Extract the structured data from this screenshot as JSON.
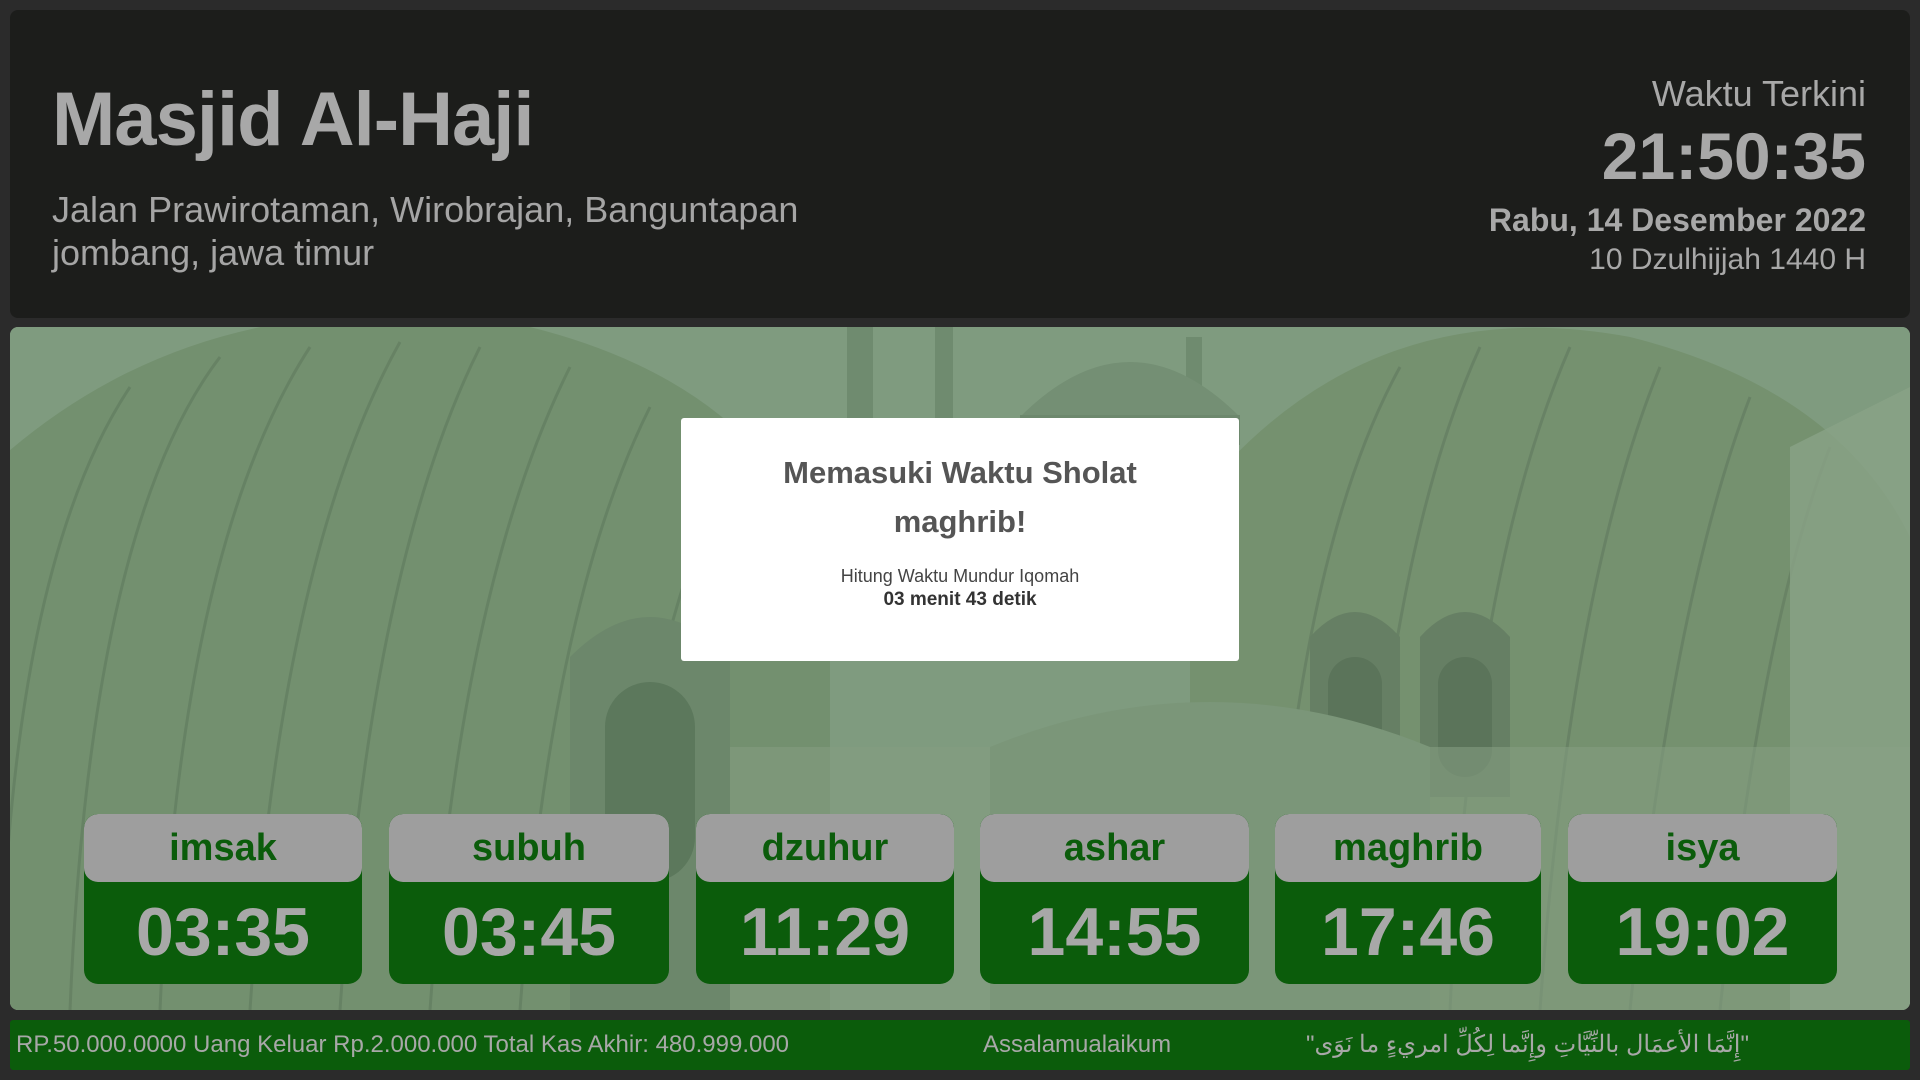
{
  "header": {
    "mosque_name": "Masjid Al-Haji",
    "address_line1": "Jalan Prawirotaman, Wirobrajan, Banguntapan",
    "address_line2": "jombang, jawa timur",
    "clock_label": "Waktu Terkini",
    "clock_time": "21:50:35",
    "date": "Rabu, 14 Desember 2022",
    "hijri_date": "10 Dzulhijjah 1440 H"
  },
  "modal": {
    "title_line1": "Memasuki Waktu Sholat",
    "title_line2": "maghrib!",
    "subtitle": "Hitung Waktu Mundur Iqomah",
    "countdown": "03 menit 43 detik"
  },
  "prayers": [
    {
      "name": "imsak",
      "time": "03:35"
    },
    {
      "name": "subuh",
      "time": "03:45"
    },
    {
      "name": "dzuhur",
      "time": "11:29"
    },
    {
      "name": "ashar",
      "time": "14:55"
    },
    {
      "name": "maghrib",
      "time": "17:46"
    },
    {
      "name": "isya",
      "time": "19:02"
    }
  ],
  "ticker": {
    "finance": "RP.50.000.0000 Uang Keluar Rp.2.000.000 Total Kas Akhir: 480.999.000",
    "greeting": "Assalamualaikum",
    "hadith": "\"إِنَّمَا الأعمَال بالنِّيَّاتِ وإِنَّما لِكُلِّ امريءٍ ما نَوَى\""
  },
  "colors": {
    "header_bg": "#1c1d1b",
    "accent_green": "#0b5c0b",
    "label_gray": "#9e9e9e",
    "text_gray": "#a8a8a8"
  }
}
